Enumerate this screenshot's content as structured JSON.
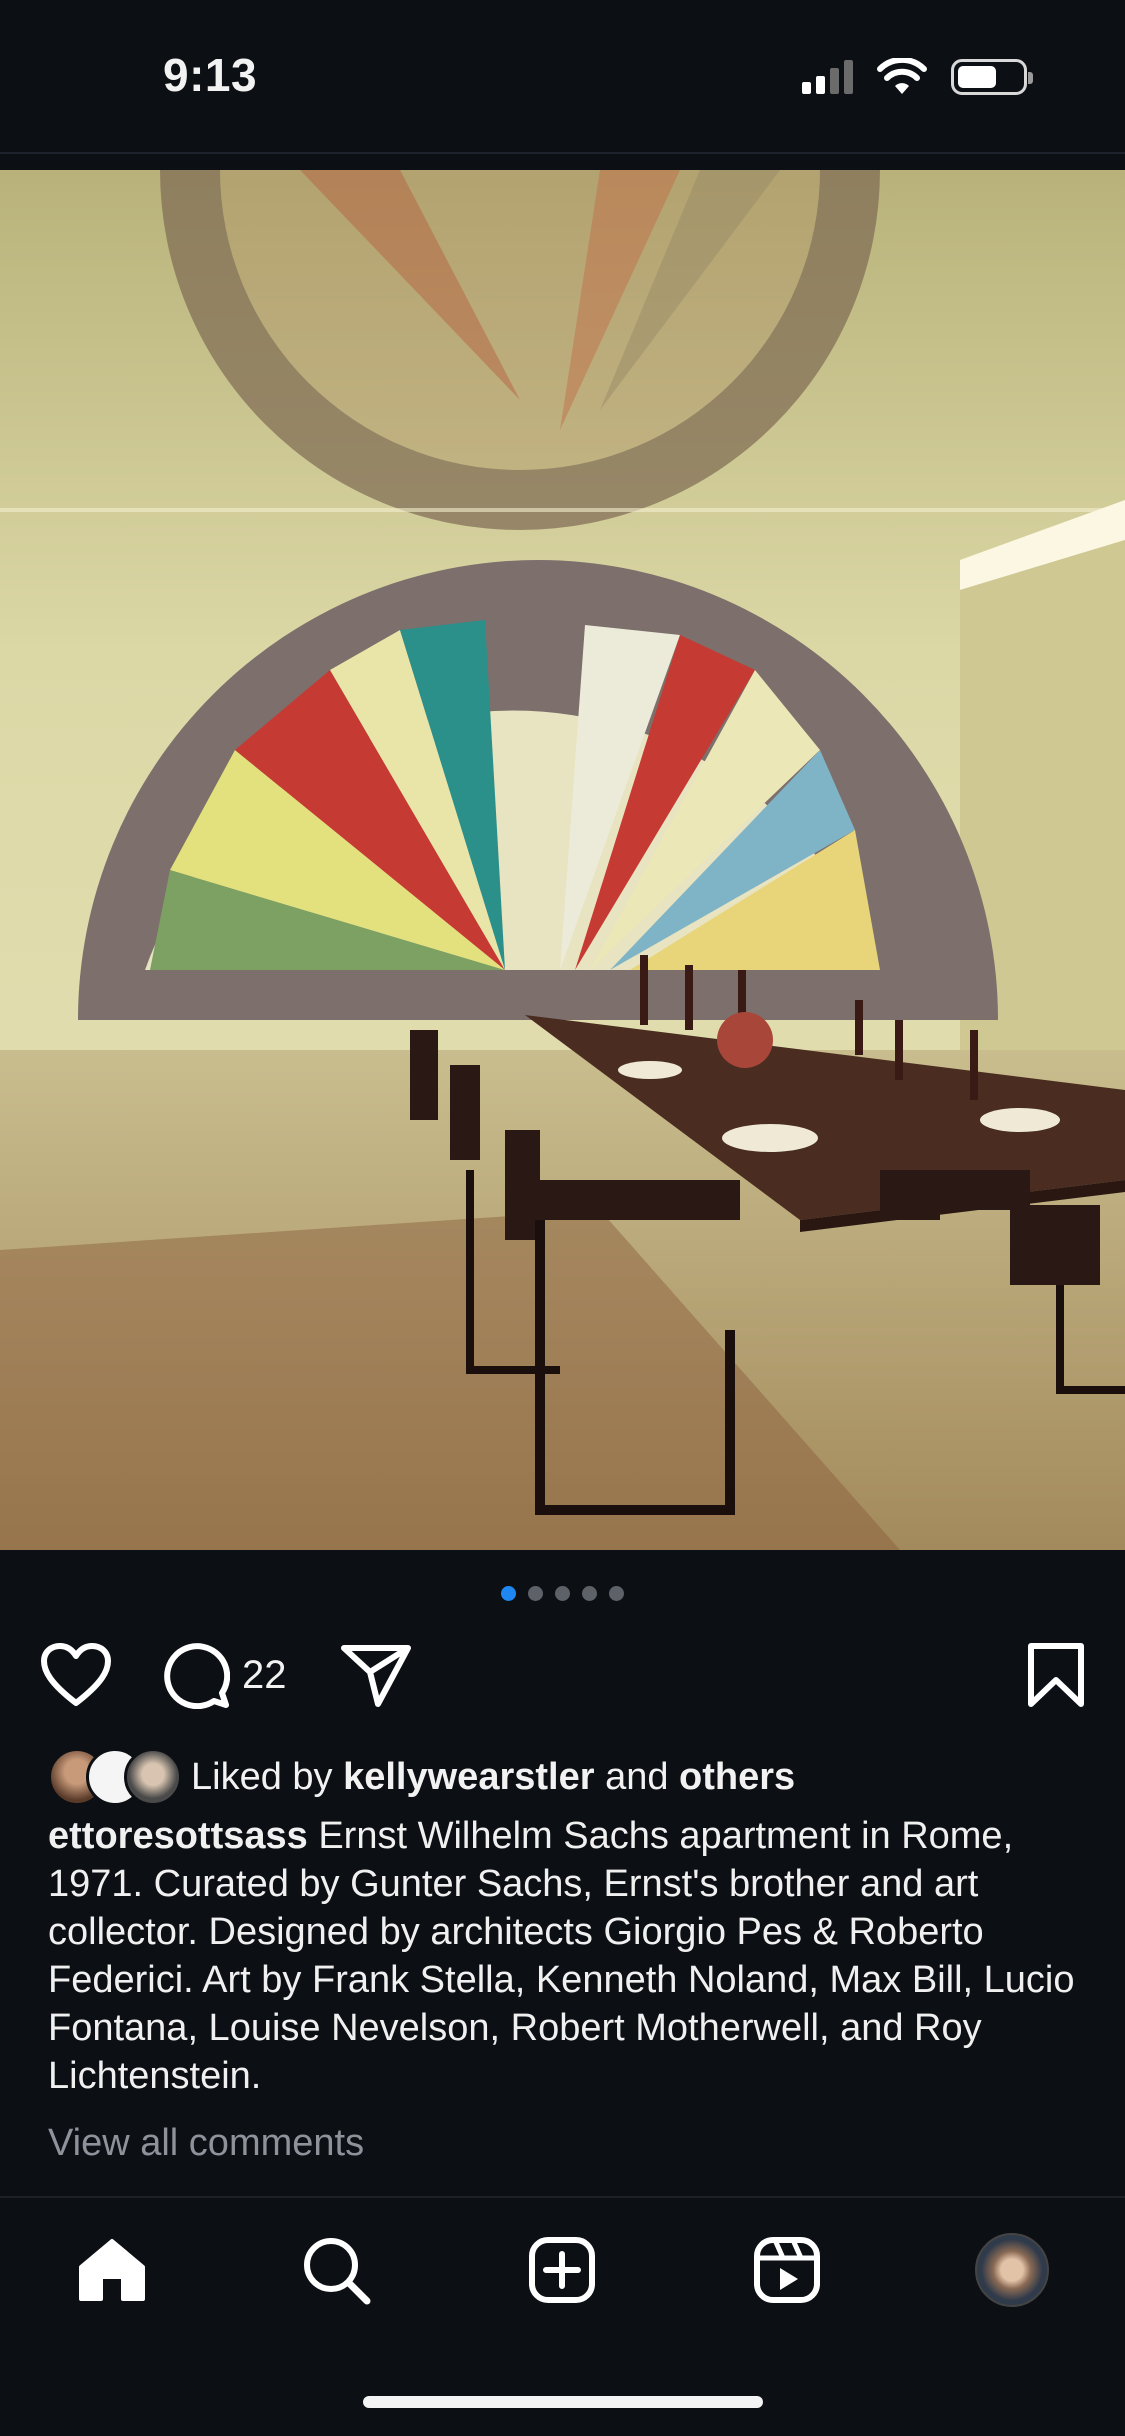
{
  "status_bar": {
    "time": "9:13"
  },
  "post": {
    "carousel": {
      "total": 5,
      "active_index": 0
    },
    "comment_count": "22",
    "likes": {
      "prefix": "Liked by",
      "user": "kellywearstler",
      "connector": "and",
      "others": "others"
    },
    "caption": {
      "username": "ettoresottsass",
      "text": "Ernst Wilhelm Sachs apartment in Rome, 1971. Curated by Gunter Sachs, Ernst's brother and art collector. Designed by architects Giorgio Pes & Roberto Federici. Art by Frank Stella, Kenneth Noland, Max Bill, Lucio Fontana, Louise Nevelson, Robert Motherwell, and Roy Lichtenstein."
    },
    "view_comments": "View all comments"
  },
  "colors": {
    "accent": "#1e88f0",
    "background": "#0c0f14"
  },
  "icons": {
    "like": "heart-icon",
    "comment": "comment-icon",
    "share": "paper-plane-icon",
    "save": "bookmark-icon",
    "nav": [
      "home-icon",
      "search-icon",
      "create-icon",
      "reels-icon",
      "profile-avatar"
    ]
  }
}
